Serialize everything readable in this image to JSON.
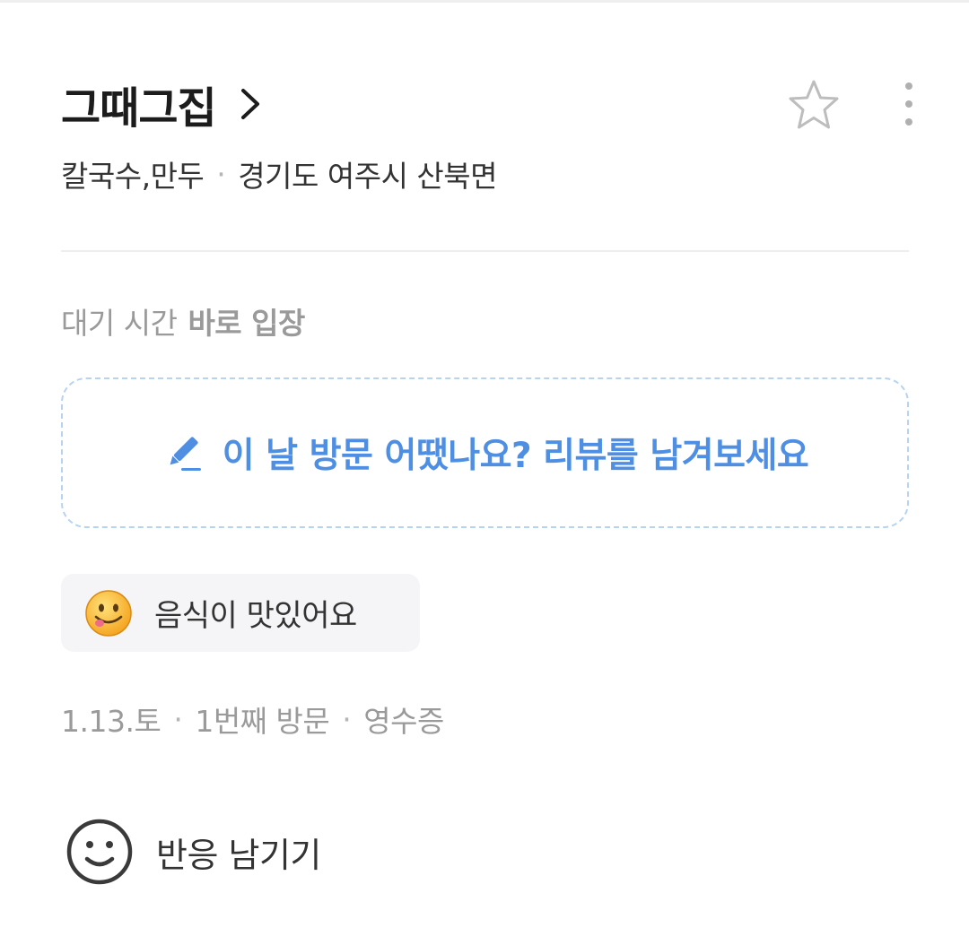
{
  "place": {
    "name": "그때그집",
    "category": "칼국수,만두",
    "separator": "·",
    "location": "경기도 여주시 산북면"
  },
  "wait": {
    "label": "대기 시간",
    "value": "바로 입장"
  },
  "review_prompt": {
    "text": "이 날 방문 어땠나요? 리뷰를 남겨보세요",
    "icon": "pencil-icon",
    "color": "#4e8fe3"
  },
  "tag_chip": {
    "icon": "yummy-face-emoji",
    "text": "음식이 맛있어요"
  },
  "visit": {
    "date": "1.13.토",
    "separator": "·",
    "visit_count": "1번째 방문",
    "verification": "영수증"
  },
  "reaction": {
    "icon": "smiley-icon",
    "label": "반응 남기기"
  },
  "actions": {
    "favorite_icon": "star-outline-icon",
    "more_icon": "more-vertical-icon",
    "chevron_icon": "chevron-right-icon"
  }
}
